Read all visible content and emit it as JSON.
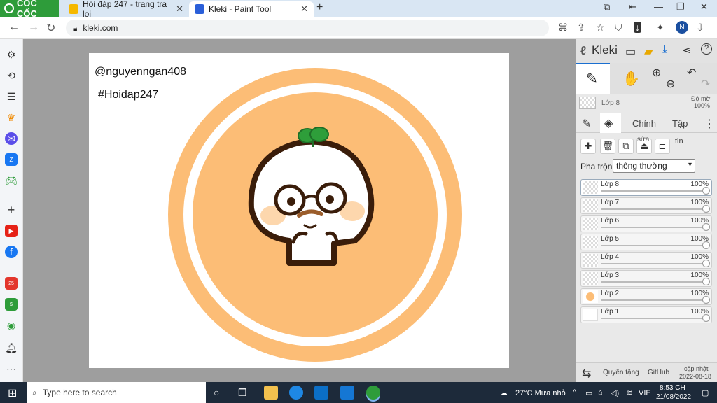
{
  "browser": {
    "brand": "CỐC CỐC",
    "tabs": [
      {
        "title": "Hỏi đáp 247 - trang tra loi",
        "active": false
      },
      {
        "title": "Kleki - Paint Tool",
        "active": true
      }
    ],
    "url": "kleki.com",
    "profile_initial": "N"
  },
  "kleki": {
    "title": "Kleki",
    "current_layer": {
      "name": "Lớp 8",
      "opacity_label": "Độ mờ",
      "opacity": "100%"
    },
    "tabs": [
      "Chỉnh",
      "Tập"
    ],
    "tab_labels_extra": [
      "sửa",
      "tin"
    ],
    "blend_label": "Pha trộn",
    "blend_value": "thông thường",
    "layers": [
      {
        "name": "Lớp 8",
        "opacity": "100%",
        "selected": true
      },
      {
        "name": "Lớp 7",
        "opacity": "100%"
      },
      {
        "name": "Lớp 6",
        "opacity": "100%"
      },
      {
        "name": "Lớp 5",
        "opacity": "100%"
      },
      {
        "name": "Lớp 4",
        "opacity": "100%"
      },
      {
        "name": "Lớp 3",
        "opacity": "100%"
      },
      {
        "name": "Lớp 2",
        "opacity": "100%"
      },
      {
        "name": "Lớp 1",
        "opacity": "100%"
      }
    ],
    "footer": {
      "privacy": "Quyền tặng",
      "github": "GitHub",
      "update_label": "cập nhật",
      "update_date": "2022-08-18"
    }
  },
  "canvas": {
    "text1": "@nguyenngan408",
    "text2": "#Hoidap247",
    "colors": {
      "ring": "#fcbd76",
      "face": "#ffffff",
      "outline": "#3a1d0a",
      "leaf": "#2e9e3a"
    }
  },
  "taskbar": {
    "search_placeholder": "Type here to search",
    "weather": "27°C  Mưa nhỏ",
    "lang": "VIE",
    "time": "8:53 CH",
    "date": "21/08/2022"
  }
}
